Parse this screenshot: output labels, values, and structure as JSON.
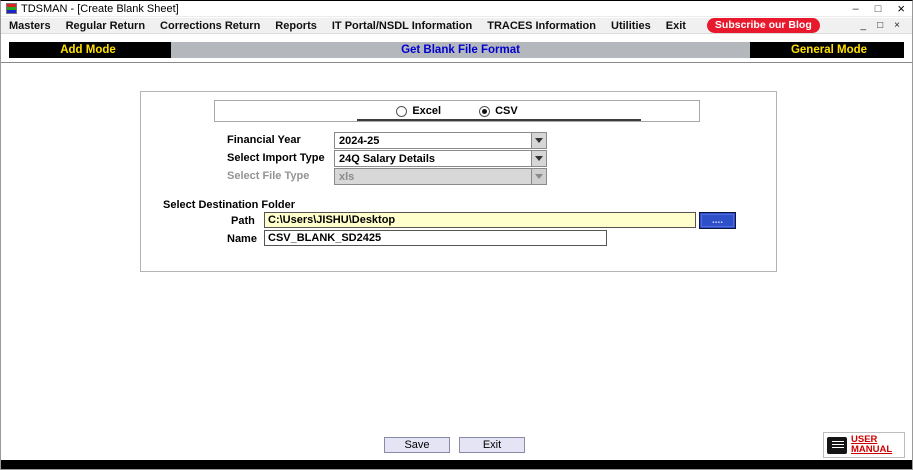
{
  "window": {
    "title": "TDSMAN - [Create Blank Sheet]"
  },
  "icons": {
    "minimize": "–",
    "maximize": "□",
    "close": "×",
    "mdi_minimize": "_",
    "mdi_restore": "□",
    "mdi_close": "×"
  },
  "menu": {
    "items": [
      "Masters",
      "Regular Return",
      "Corrections Return",
      "Reports",
      "IT Portal/NSDL Information",
      "TRACES Information",
      "Utilities",
      "Exit"
    ],
    "subscribe": "Subscribe our Blog"
  },
  "header": {
    "left": "Add Mode",
    "center": "Get Blank File Format",
    "right": "General Mode"
  },
  "form": {
    "radio_excel": "Excel",
    "radio_csv": "CSV",
    "financial_year_label": "Financial Year",
    "financial_year_value": "2024-25",
    "import_type_label": "Select Import Type",
    "import_type_value": "24Q Salary Details",
    "file_type_label": "Select File Type",
    "file_type_value": "xls",
    "dest_folder_label": "Select Destination Folder",
    "path_label": "Path",
    "path_value": "C:\\Users\\JISHU\\Desktop",
    "browse_label": "....",
    "name_label": "Name",
    "name_value": "CSV_BLANK_SD2425"
  },
  "footer": {
    "save": "Save",
    "exit": "Exit",
    "user_manual_line1": "USER",
    "user_manual_line2": "MANUAL"
  },
  "colors": {
    "accent_yellow": "#ffe000",
    "accent_blue": "#0000d0",
    "subscribe_red": "#e8192c",
    "path_field_bg": "#ffffcc",
    "browse_blue": "#2f4fc8",
    "manual_red": "#cc0000"
  }
}
